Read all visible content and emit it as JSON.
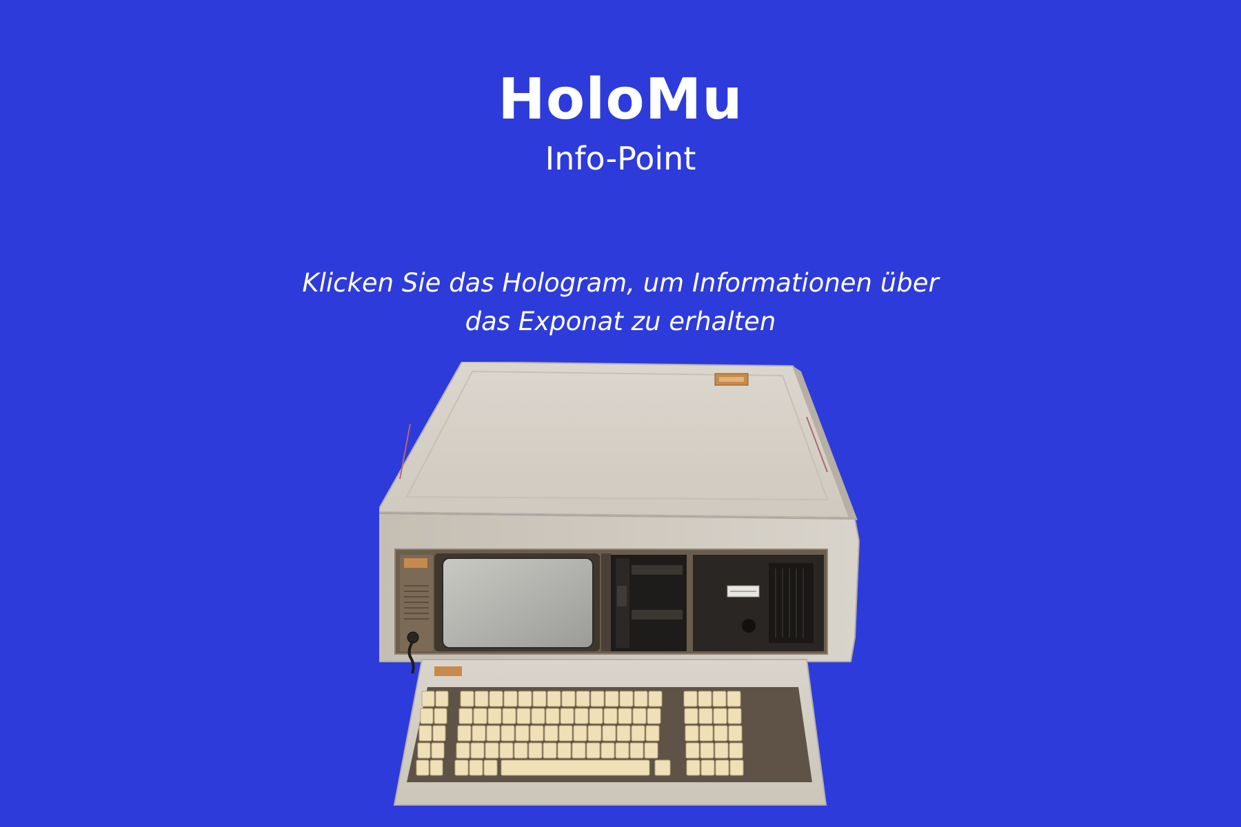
{
  "header": {
    "title": "HoloMu",
    "subtitle": "Info-Point"
  },
  "instruction": {
    "line1": "Klicken Sie das Hologram, um Informationen über",
    "line2": "das Exponat zu erhalten"
  },
  "colors": {
    "background": "#2d3bdb",
    "text": "#ffffff",
    "case": "#d8d3ca",
    "keycap": "#f0e0b8"
  }
}
